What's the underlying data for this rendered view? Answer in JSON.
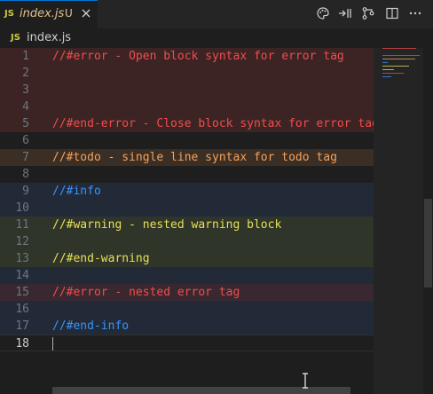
{
  "tab": {
    "lang_badge": "JS",
    "filename": "index.js",
    "modified": "U"
  },
  "breadcrumb": {
    "lang_badge": "JS",
    "filename": "index.js"
  },
  "icons": {
    "tab_close": "close-icon",
    "actions": [
      "color-palette-icon",
      "compare-changes-icon",
      "source-control-graph-icon",
      "split-editor-icon",
      "more-actions-icon"
    ]
  },
  "colors": {
    "error_text": "#f14c4c",
    "error_bg": "#3c2424",
    "todo_text": "#f5a15c",
    "todo_bg": "#3b2e24",
    "info_text": "#3794ff",
    "info_bg": "#222a38",
    "warning_text": "#e7e05a",
    "warning_bg": "#2f3528",
    "nested_error_bg": "#3a2830"
  },
  "lines": [
    {
      "n": "1",
      "text": "//#error - Open block syntax for error tag",
      "kind": "error"
    },
    {
      "n": "2",
      "text": "",
      "kind": "error"
    },
    {
      "n": "3",
      "text": "",
      "kind": "error"
    },
    {
      "n": "4",
      "text": "",
      "kind": "error"
    },
    {
      "n": "5",
      "text": "//#end-error - Close block syntax for error tag",
      "kind": "error"
    },
    {
      "n": "6",
      "text": "",
      "kind": "plain"
    },
    {
      "n": "7",
      "text": "//#todo - single line syntax for todo tag",
      "kind": "todo"
    },
    {
      "n": "8",
      "text": "",
      "kind": "plain"
    },
    {
      "n": "9",
      "text": "//#info",
      "kind": "info"
    },
    {
      "n": "10",
      "text": "",
      "kind": "info"
    },
    {
      "n": "11",
      "text": "//#warning - nested warning block",
      "kind": "warning"
    },
    {
      "n": "12",
      "text": "",
      "kind": "warning"
    },
    {
      "n": "13",
      "text": "//#end-warning",
      "kind": "warning"
    },
    {
      "n": "14",
      "text": "",
      "kind": "info"
    },
    {
      "n": "15",
      "text": "//#error - nested error tag",
      "kind": "nested-error"
    },
    {
      "n": "16",
      "text": "",
      "kind": "info"
    },
    {
      "n": "17",
      "text": "//#end-info",
      "kind": "info"
    },
    {
      "n": "18",
      "text": "",
      "kind": "current"
    }
  ]
}
